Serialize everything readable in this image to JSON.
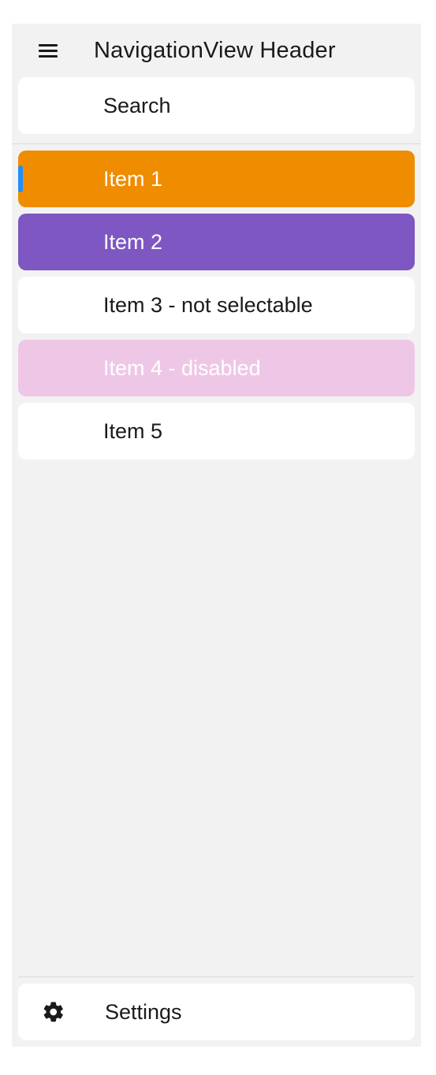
{
  "header": {
    "title": "NavigationView Header"
  },
  "search": {
    "placeholder": "Search",
    "value": ""
  },
  "items": [
    {
      "label": "Item 1",
      "bg": "#f08c00",
      "fg": "#ffffff",
      "selected": true,
      "interactable": true
    },
    {
      "label": "Item 2",
      "bg": "#7e57c2",
      "fg": "#ffffff",
      "selected": false,
      "interactable": true
    },
    {
      "label": "Item 3 - not selectable",
      "bg": "#ffffff",
      "fg": "#1a1a1a",
      "selected": false,
      "interactable": false
    },
    {
      "label": "Item 4 - disabled",
      "bg": "#efc7e6",
      "fg": "#ffffff",
      "selected": false,
      "interactable": false
    },
    {
      "label": "Item 5",
      "bg": "#ffffff",
      "fg": "#1a1a1a",
      "selected": false,
      "interactable": true
    }
  ],
  "footer": {
    "settings_label": "Settings"
  }
}
